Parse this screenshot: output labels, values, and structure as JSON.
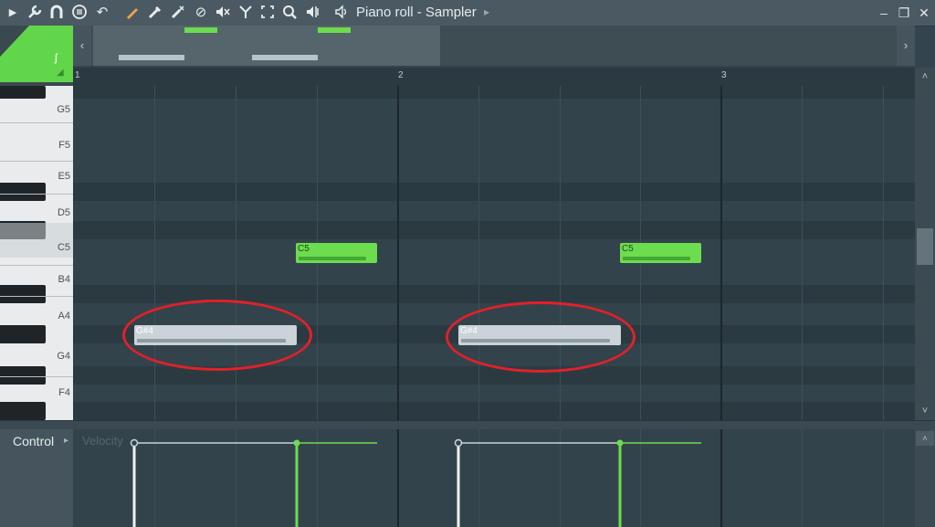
{
  "toolbar": {
    "icons": [
      "play-arrow-icon",
      "wrench-icon",
      "magnet-icon",
      "menu-circle-icon",
      "undo-icon",
      "pencil-icon",
      "paint-brush-icon",
      "delete-brush-icon",
      "mute-icon",
      "slice-icon",
      "select-icon",
      "zoom-icon",
      "playback-icon"
    ],
    "title": "Piano roll - Sampler",
    "window_buttons": [
      "minimize",
      "restore",
      "close"
    ]
  },
  "timeline": {
    "bars": [
      "1",
      "2",
      "3"
    ]
  },
  "keyboard": {
    "labels": [
      "G5",
      "F5",
      "E5",
      "D5",
      "C5",
      "B4",
      "A4",
      "G4",
      "F4"
    ]
  },
  "notes": [
    {
      "label": "C5",
      "color": "#6ddc4e"
    },
    {
      "label": "C5",
      "color": "#6ddc4e"
    },
    {
      "label": "G#4",
      "color": "#c9d3d8"
    },
    {
      "label": "G#4",
      "color": "#c9d3d8"
    }
  ],
  "control": {
    "label": "Control",
    "parameter": "Velocity"
  },
  "colors": {
    "accent": "#62d64a",
    "annotation": "#e0212a",
    "selected_note": "#c9d3d8"
  }
}
